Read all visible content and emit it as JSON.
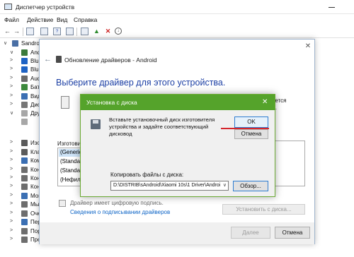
{
  "device_manager": {
    "title": "Диспетчер устройств",
    "menu": [
      "Файл",
      "Действие",
      "Вид",
      "Справка"
    ],
    "tree": [
      {
        "expander": "∨",
        "label": "Sandro",
        "icon_color": "#4a6fa5"
      },
      {
        "expander": "∨",
        "label": "Andr",
        "icon_color": "#3b7a3b"
      },
      {
        "expander": ">",
        "label": "Blue",
        "icon_color": "#1e63c4"
      },
      {
        "expander": ">",
        "label": "Blue",
        "icon_color": "#1e63c4"
      },
      {
        "expander": ">",
        "label": "Audi",
        "icon_color": "#6b6b6b"
      },
      {
        "expander": ">",
        "label": "Бат",
        "icon_color": "#3d8a3d"
      },
      {
        "expander": ">",
        "label": "Вид",
        "icon_color": "#3b6fb3"
      },
      {
        "expander": ">",
        "label": "Дис",
        "icon_color": "#777777"
      },
      {
        "expander": "∨",
        "label": "Дру",
        "icon_color": "#a7a7a7"
      },
      {
        "expander": "",
        "label": "",
        "icon_color": "#a7a7a7"
      },
      {
        "expander": ">",
        "label": "Изо",
        "icon_color": "#5b5b5b"
      },
      {
        "expander": ">",
        "label": "Кла",
        "icon_color": "#5b5b5b"
      },
      {
        "expander": ">",
        "label": "Ком",
        "icon_color": "#3b6fb3"
      },
      {
        "expander": ">",
        "label": "Кон",
        "icon_color": "#6e6e6e"
      },
      {
        "expander": ">",
        "label": "Кон",
        "icon_color": "#6e6e6e"
      },
      {
        "expander": ">",
        "label": "Кон",
        "icon_color": "#6e6e6e"
      },
      {
        "expander": ">",
        "label": "Мон",
        "icon_color": "#3b6fb3"
      },
      {
        "expander": ">",
        "label": "Мы",
        "icon_color": "#6e6e6e"
      },
      {
        "expander": ">",
        "label": "Оче",
        "icon_color": "#6e6e6e"
      },
      {
        "expander": ">",
        "label": "Пер",
        "icon_color": "#3b6fb3"
      },
      {
        "expander": ">",
        "label": "Пор",
        "icon_color": "#6e6e6e"
      },
      {
        "expander": ">",
        "label": "Программные устройства",
        "icon_color": "#6e6e6e"
      }
    ]
  },
  "wizard": {
    "header": "Обновление драйверов - Android",
    "heading": "Выберите драйвер для этого устройства.",
    "side_text_line1": "имеется",
    "side_text_line2": "иск\".",
    "list_header": "Изготови",
    "list_items": [
      "(Generic",
      "(Standard",
      "(Standard",
      "(Нефильтр"
    ],
    "signature_text": "Драйвер имеет цифровую подпись.",
    "signature_link": "Сведения о подписывании драйверов",
    "have_disk": "Установить с диска...",
    "next": "Далее",
    "cancel": "Отмена"
  },
  "disk_dialog": {
    "title": "Установка с диска",
    "message": "Вставьте установочный диск изготовителя устройства и задайте соответствующий дисковод",
    "ok": "OK",
    "cancel": "Отмена",
    "copy_label": "Копировать файлы с диска:",
    "path": "D:\\DISTRIB\\sAndroid\\Xiaomi 10s\\1 Driver\\Androi",
    "browse": "Обзор..."
  },
  "colors": {
    "dialog_titlebar": "#55a32b",
    "heading_blue": "#1c3fa4",
    "link_blue": "#0b63c6",
    "annotation_red": "#d4262c"
  }
}
